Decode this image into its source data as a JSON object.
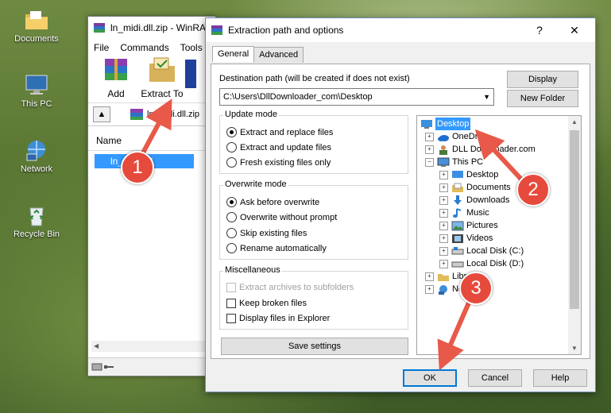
{
  "desktop": {
    "icons": [
      {
        "label": "Documents"
      },
      {
        "label": "This PC"
      },
      {
        "label": "Network"
      },
      {
        "label": "Recycle Bin"
      }
    ]
  },
  "winrar": {
    "title": "ln_midi.dll.zip - WinRAR",
    "menu": [
      "File",
      "Commands",
      "Tools"
    ],
    "toolbar": {
      "add": "Add",
      "extract_to": "Extract To"
    },
    "path": "ln_midi.dll.zip",
    "column_name": "Name",
    "file": "ln_midi.dll"
  },
  "dialog": {
    "title": "Extraction path and options",
    "help_btn": "?",
    "close_btn": "✕",
    "tabs": [
      "General",
      "Advanced"
    ],
    "dest_label": "Destination path (will be created if does not exist)",
    "dest_value": "C:\\Users\\DllDownloader_com\\Desktop",
    "display_btn": "Display",
    "new_folder_btn": "New Folder",
    "update_mode": {
      "title": "Update mode",
      "options": [
        "Extract and replace files",
        "Extract and update files",
        "Fresh existing files only"
      ],
      "selected": 0
    },
    "overwrite_mode": {
      "title": "Overwrite mode",
      "options": [
        "Ask before overwrite",
        "Overwrite without prompt",
        "Skip existing files",
        "Rename automatically"
      ],
      "selected": 0
    },
    "misc": {
      "title": "Miscellaneous",
      "options": [
        "Extract archives to subfolders",
        "Keep broken files",
        "Display files in Explorer"
      ]
    },
    "save_settings": "Save settings",
    "tree": [
      {
        "label": "Desktop",
        "selected": true
      },
      {
        "label": "OneDrive"
      },
      {
        "label": "DLL Downloader.com"
      },
      {
        "label": "This PC"
      },
      {
        "label": "Desktop"
      },
      {
        "label": "Documents"
      },
      {
        "label": "Downloads"
      },
      {
        "label": "Music"
      },
      {
        "label": "Pictures"
      },
      {
        "label": "Videos"
      },
      {
        "label": "Local Disk (C:)"
      },
      {
        "label": "Local Disk (D:)"
      },
      {
        "label": "Libraries"
      },
      {
        "label": "Network"
      }
    ],
    "ok_btn": "OK",
    "cancel_btn": "Cancel",
    "help_bottom_btn": "Help"
  },
  "callouts": [
    "1",
    "2",
    "3"
  ],
  "colors": {
    "callout": "#e64a3c",
    "selection": "#3399ff",
    "arrow": "#e8594a"
  }
}
